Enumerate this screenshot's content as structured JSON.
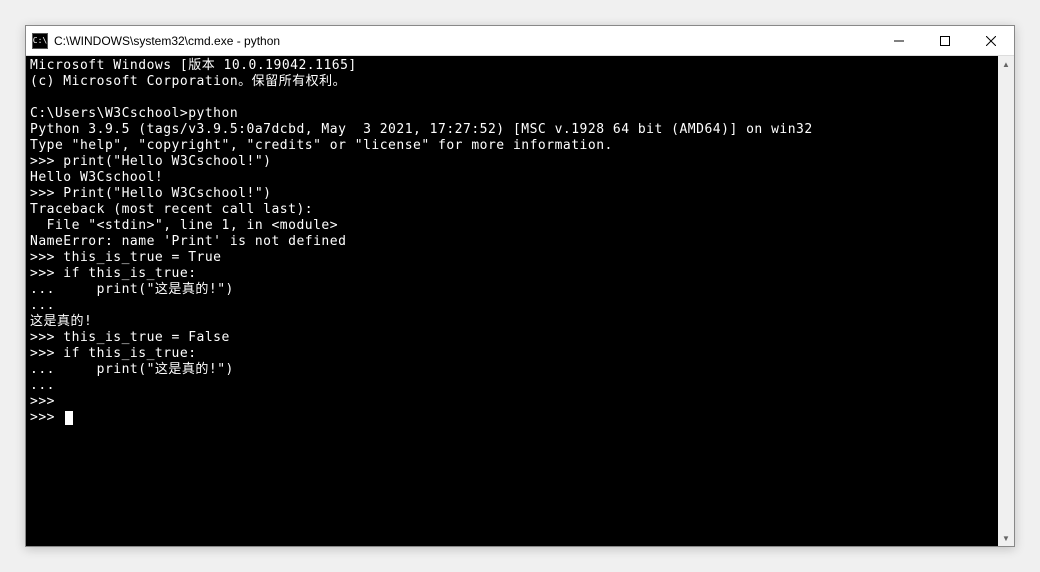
{
  "window": {
    "title": "C:\\WINDOWS\\system32\\cmd.exe - python"
  },
  "terminal": {
    "lines": [
      "Microsoft Windows [版本 10.0.19042.1165]",
      "(c) Microsoft Corporation。保留所有权利。",
      "",
      "C:\\Users\\W3Cschool>python",
      "Python 3.9.5 (tags/v3.9.5:0a7dcbd, May  3 2021, 17:27:52) [MSC v.1928 64 bit (AMD64)] on win32",
      "Type \"help\", \"copyright\", \"credits\" or \"license\" for more information.",
      ">>> print(\"Hello W3Cschool!\")",
      "Hello W3Cschool!",
      ">>> Print(\"Hello W3Cschool!\")",
      "Traceback (most recent call last):",
      "  File \"<stdin>\", line 1, in <module>",
      "NameError: name 'Print' is not defined",
      ">>> this_is_true = True",
      ">>> if this_is_true:",
      "...     print(\"这是真的!\")",
      "...",
      "这是真的!",
      ">>> this_is_true = False",
      ">>> if this_is_true:",
      "...     print(\"这是真的!\")",
      "...",
      ">>>",
      ">>> "
    ]
  }
}
